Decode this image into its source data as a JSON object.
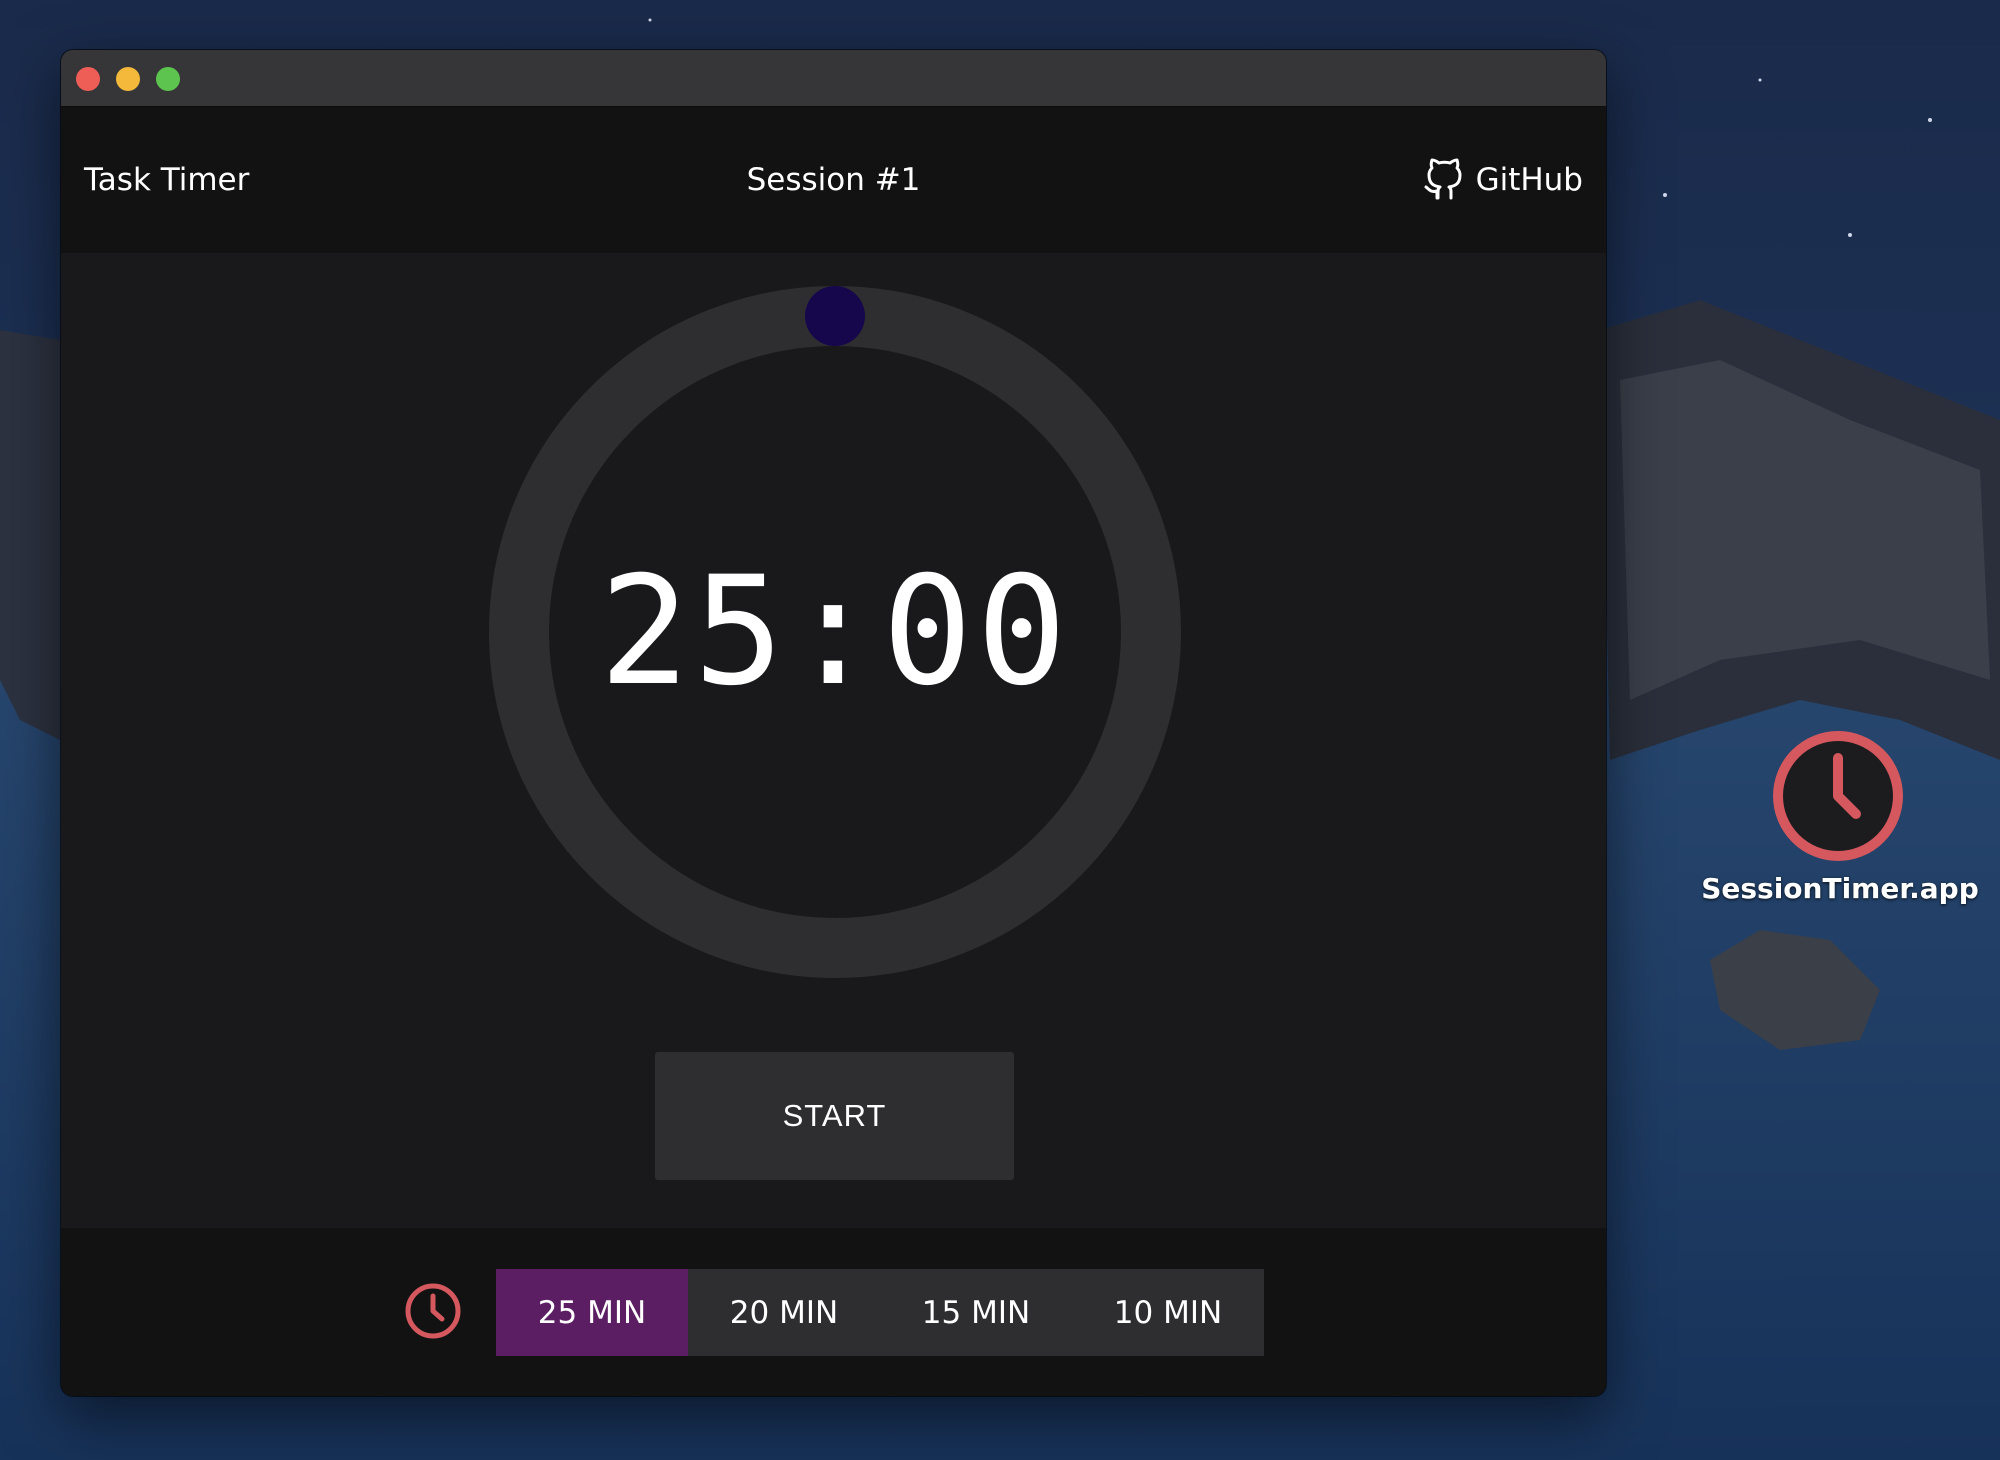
{
  "window": {
    "controls": [
      "close",
      "minimize",
      "maximize"
    ]
  },
  "header": {
    "app_title": "Task Timer",
    "session_title": "Session #1",
    "github_label": "GitHub",
    "github_icon": "github-icon"
  },
  "timer": {
    "display": "25:00",
    "progress": 0,
    "ring_color": "#2e2e30",
    "indicator_color": "#16064c"
  },
  "controls": {
    "start_label": "START"
  },
  "durations": {
    "icon": "clock-icon",
    "icon_color": "#d4585e",
    "options": [
      {
        "label": "25 MIN",
        "selected": true
      },
      {
        "label": "20 MIN",
        "selected": false
      },
      {
        "label": "15 MIN",
        "selected": false
      },
      {
        "label": "10 MIN",
        "selected": false
      }
    ],
    "selected_color": "#5b1e63"
  },
  "desktop": {
    "app_icon": "clock-icon",
    "app_label": "SessionTimer.app"
  }
}
